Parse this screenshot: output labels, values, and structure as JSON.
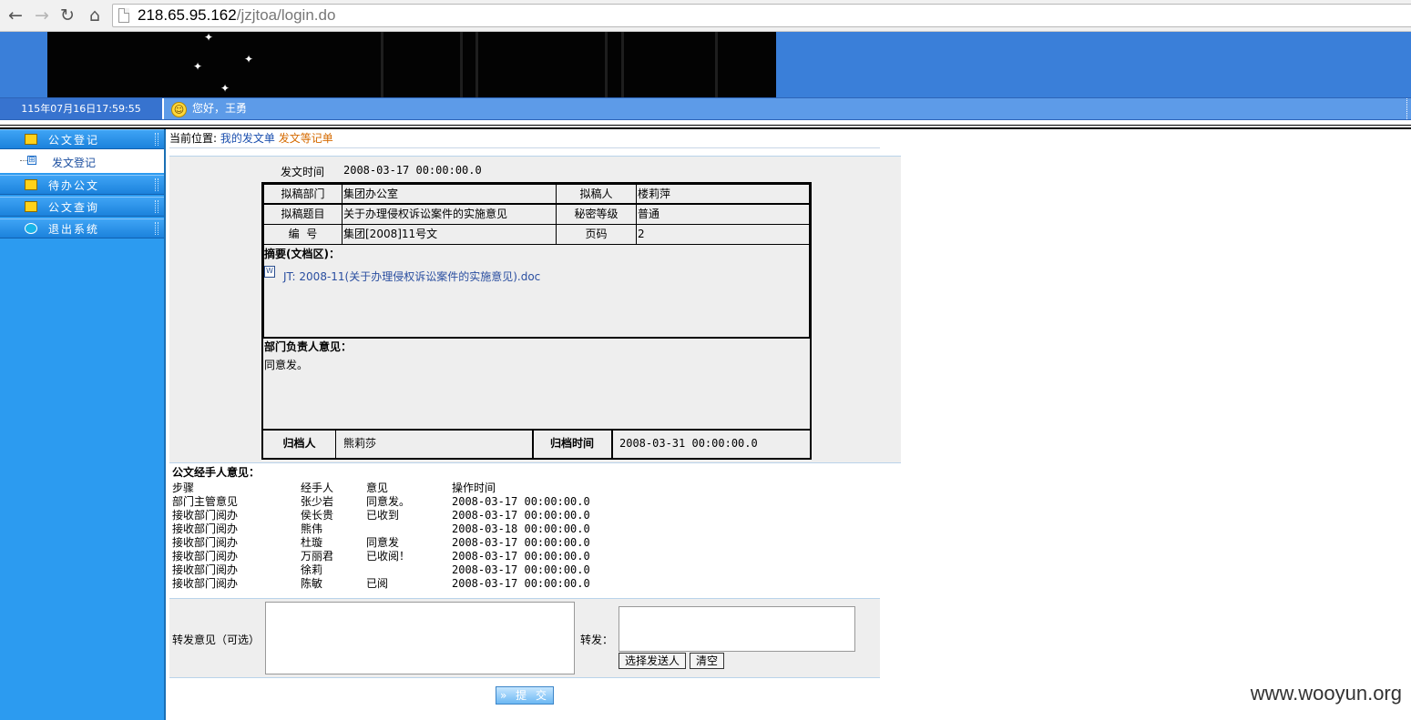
{
  "browser": {
    "url_host": "218.65.95.162",
    "url_path": "/jzjtoa/login.do",
    "back_glyph": "←",
    "forward_glyph": "→",
    "reload_glyph": "↻",
    "home_glyph": "⌂"
  },
  "header": {
    "datetime": "115年07月16日17:59:55",
    "greeting": "您好，王勇"
  },
  "sidebar": {
    "items": [
      {
        "label": "公文登记",
        "icon": "folder-icon"
      },
      {
        "label": "待办公文",
        "icon": "folder-icon"
      },
      {
        "label": "公文查询",
        "icon": "folder-icon"
      },
      {
        "label": "退出系统",
        "icon": "exit-icon"
      }
    ],
    "sub_item": "发文登记",
    "tree_glyph": "⊞"
  },
  "breadcrumb": {
    "prefix": "当前位置:",
    "part1": "我的发文单",
    "part2": "发文等记单"
  },
  "form": {
    "issue_time_label": "发文时间",
    "issue_time": "2008-03-17 00:00:00.0",
    "draft_dept_label": "拟稿部门",
    "draft_dept": "集团办公室",
    "drafter_label": "拟稿人",
    "drafter": "楼莉萍",
    "subject_label": "拟稿题目",
    "subject": "关于办理侵权诉讼案件的实施意见",
    "secret_label": "秘密等级",
    "secret": "普通",
    "number_label": "编  号",
    "number": "集团[2008]11号文",
    "pages_label": "页码",
    "pages": "2",
    "summary_title": "摘要(文档区)：",
    "doc_icon_glyph": "W",
    "doc_link": "JT: 2008-11(关于办理侵权诉讼案件的实施意见).doc",
    "dept_head_title": "部门负责人意见：",
    "dept_head_opinion": "同意发。",
    "archiver_label": "归档人",
    "archiver": "熊莉莎",
    "archive_time_label": "归档时间",
    "archive_time": "2008-03-31 00:00:00.0"
  },
  "opinions": {
    "title": "公文经手人意见：",
    "headers": [
      "步骤",
      "经手人",
      "意见",
      "操作时间"
    ],
    "rows": [
      [
        "部门主管意见",
        "张少岩",
        "同意发。",
        "2008-03-17 00:00:00.0"
      ],
      [
        "接收部门阅办",
        "侯长贵",
        "已收到",
        "2008-03-17 00:00:00.0"
      ],
      [
        "接收部门阅办",
        "熊伟",
        "",
        "2008-03-18 00:00:00.0"
      ],
      [
        "接收部门阅办",
        "杜璇",
        "同意发",
        "2008-03-17 00:00:00.0"
      ],
      [
        "接收部门阅办",
        "万丽君",
        "已收阅！",
        "2008-03-17 00:00:00.0"
      ],
      [
        "接收部门阅办",
        "徐莉",
        "",
        "2008-03-17 00:00:00.0"
      ],
      [
        "接收部门阅办",
        "陈敏",
        "已阅",
        "2008-03-17 00:00:00.0"
      ]
    ]
  },
  "forward": {
    "opinion_label": "转发意见（可选）",
    "to_label": "转发：",
    "select_button": "选择发送人",
    "clear_button": "清空",
    "submit_button": "» 提 交"
  },
  "watermark": "www.wooyun.org",
  "colors": {
    "banner_blue": "#3a7fd9",
    "sidebar_blue": "#2c9bf0",
    "link_blue": "#1b4fae",
    "link_orange": "#d56a00"
  }
}
